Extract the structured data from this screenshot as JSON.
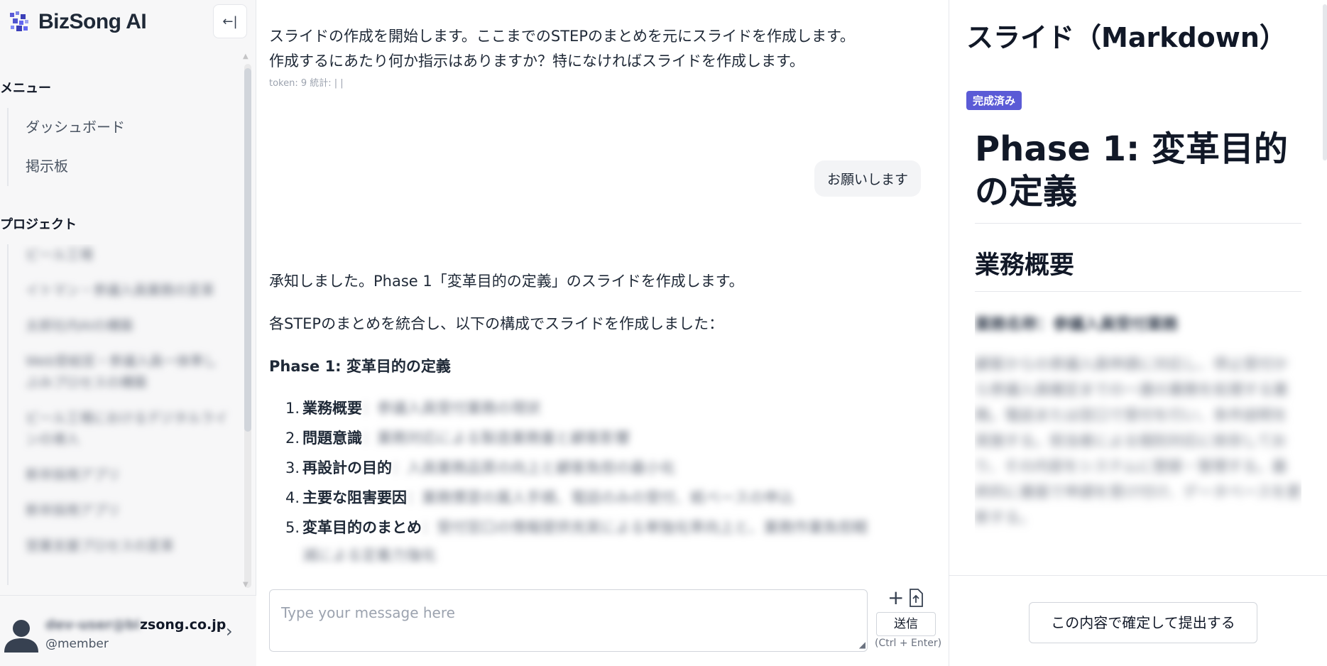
{
  "app": {
    "brand": "BizSong AI"
  },
  "sidebar": {
    "collapse_icon": "collapse-left-icon",
    "menu_title": "メニュー",
    "menu_items": [
      {
        "label": "ダッシュボード"
      },
      {
        "label": "掲示板"
      }
    ],
    "projects_title": "プロジェクト",
    "projects": [
      {
        "label": "ビール工場"
      },
      {
        "label": "イトマン・参議入員業務の変革"
      },
      {
        "label": "太郎社内AIの構築"
      },
      {
        "label": "Web受給窓・参議入員一体準しぶみプロセスの構築"
      },
      {
        "label": "ビール工場におけるデジタルラインの導入"
      },
      {
        "label": "新卒採用アプリ"
      },
      {
        "label": "新卒採用アプリ"
      },
      {
        "label": "営業支援プロセスの変革"
      }
    ],
    "user": {
      "email_masked": "dev-user@bi",
      "email_visible": "zsong.co.jp",
      "role": "@member"
    }
  },
  "chat": {
    "ai_message_1_line1": "スライドの作成を開始します。ここまでのSTEPのまとめを元にスライドを作成します。",
    "ai_message_1_line2": "作成するにあたり何か指示はありますか？特になければスライドを作成します。",
    "token_info": "token: 9 統計: | |",
    "user_message": "お願いします",
    "ai_message_2_line1": "承知しました。Phase 1「変革目的の定義」のスライドを作成します。",
    "ai_message_2_line2": "各STEPのまとめを統合し、以下の構成でスライドを作成しました：",
    "ai_message_2_heading": "Phase 1: 変革目的の定義",
    "list": [
      {
        "num": "1.",
        "head": "業務概要",
        "rest": "：参議入員受付業務の現状"
      },
      {
        "num": "2.",
        "head": "問題意識",
        "rest": "：業務対応による製造業務量と顧客影響"
      },
      {
        "num": "3.",
        "head": "再設計の目的",
        "rest": "：入員業務品質の向上と顧客負担の最小化"
      },
      {
        "num": "4.",
        "head": "主要な阻害要因",
        "rest": "：業務慣習の属人手順、電話のみの受付、紙ベースの申込"
      },
      {
        "num": "5.",
        "head": "変革目的のまとめ",
        "rest": "：受付窓口の情報提供充実による単独化率向上と、業務作業負担軽"
      }
    ],
    "list_wrap": "減による定着力強化",
    "input_placeholder": "Type your message here",
    "send_label": "送信",
    "send_hint": "(Ctrl + Enter)"
  },
  "panel": {
    "title": "スライド（Markdown）",
    "badge": "完成済み",
    "doc_h1": "Phase 1: 変革目的の定義",
    "doc_h2": "業務概要",
    "doc_sub": "業務名称：参議入員受付業務",
    "doc_para": "顧客からの参議入員申請に対応し、停止受付から参議入員確定までの一連の業務を処理する業務。電話または窓口で受付を行い、条件説明を実施する。担当者による個別対応に依存しており、その内容をシステムに登録・管理する。最終的に書面で申請を受け付け、データベースを更新する。",
    "submit_label": "この内容で確定して提出する"
  }
}
